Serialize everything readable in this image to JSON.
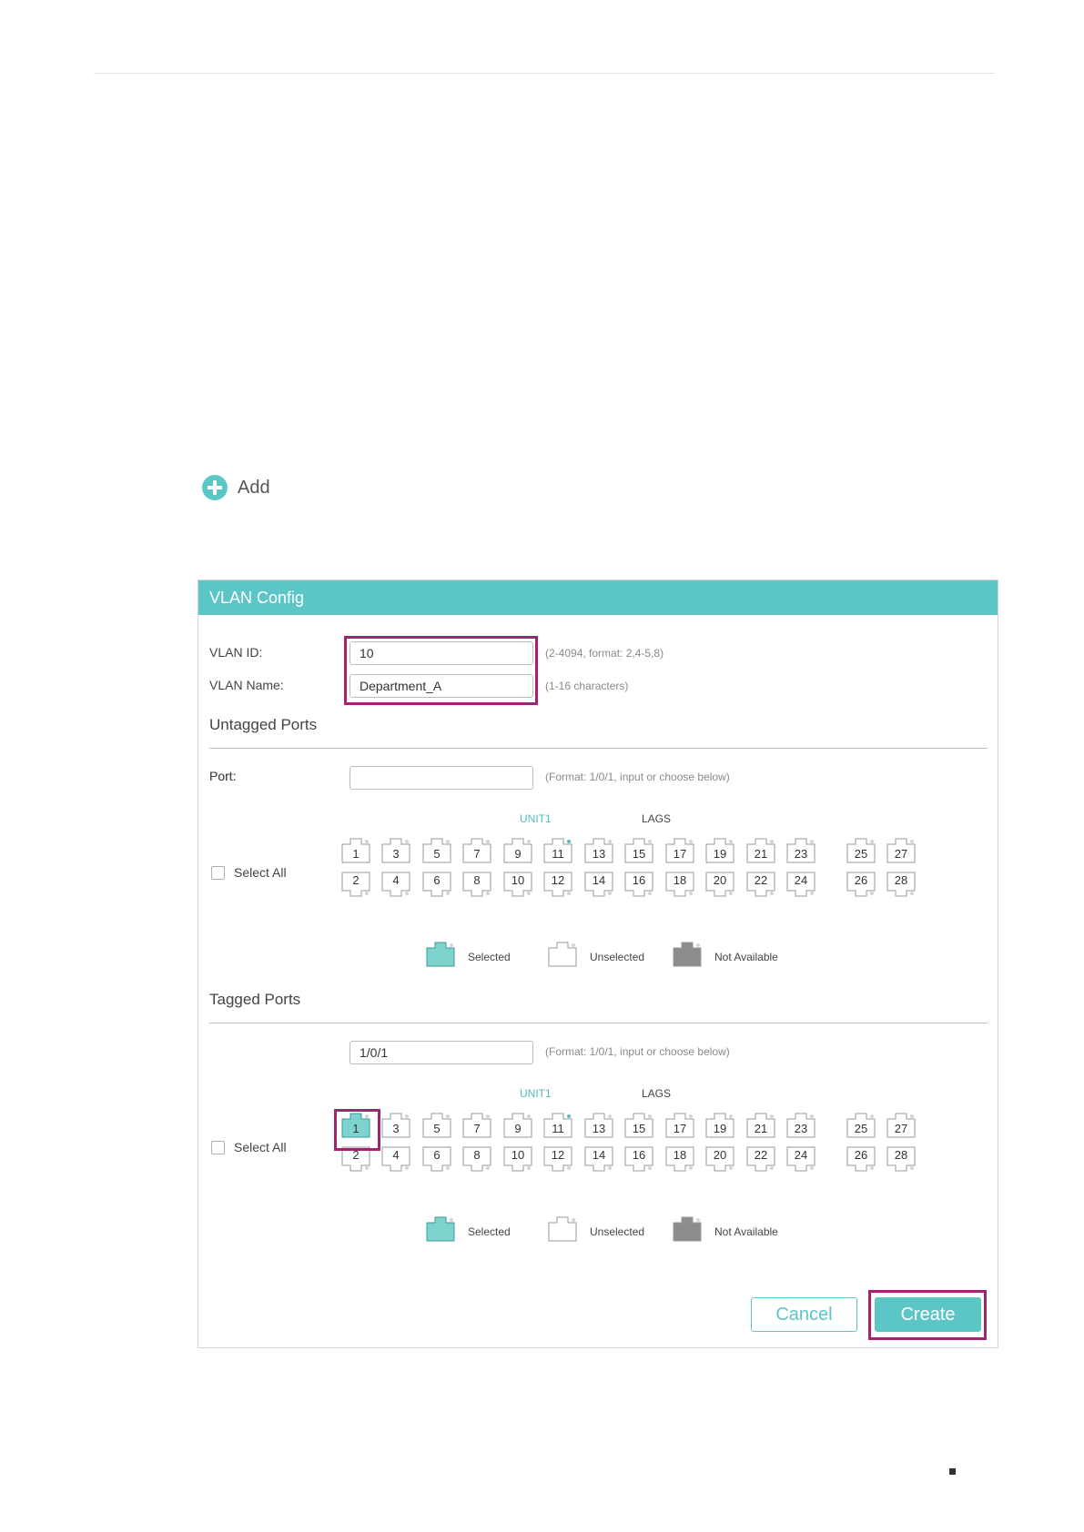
{
  "add": {
    "label": "Add"
  },
  "panel": {
    "title": "VLAN Config"
  },
  "vlan_id": {
    "label": "VLAN ID:",
    "value": "10",
    "hint": "(2-4094, format: 2,4-5,8)"
  },
  "vlan_name": {
    "label": "VLAN Name:",
    "value": "Department_A",
    "hint": "(1-16 characters)"
  },
  "untagged": {
    "title": "Untagged Ports",
    "port_label": "Port:",
    "port_value": "",
    "port_hint": "(Format: 1/0/1, input or choose below)",
    "unit_label": "UNIT1",
    "lags_label": "LAGS",
    "select_all": "Select All",
    "selected_ports": []
  },
  "tagged": {
    "title": "Tagged Ports",
    "port_label": "Port:",
    "port_value": "1/0/1",
    "port_hint": "(Format: 1/0/1, input or choose below)",
    "unit_label": "UNIT1",
    "lags_label": "LAGS",
    "select_all": "Select All",
    "selected_ports": [
      "1"
    ]
  },
  "ports": {
    "top": [
      "1",
      "3",
      "5",
      "7",
      "9",
      "11",
      "13",
      "15",
      "17",
      "19",
      "21",
      "23",
      "25",
      "27"
    ],
    "bottom": [
      "2",
      "4",
      "6",
      "8",
      "10",
      "12",
      "14",
      "16",
      "18",
      "20",
      "22",
      "24",
      "26",
      "28"
    ]
  },
  "legend": {
    "selected": "Selected",
    "unselected": "Unselected",
    "not_available": "Not Available"
  },
  "buttons": {
    "cancel": "Cancel",
    "create": "Create"
  },
  "colors": {
    "accent": "#5cc6c6",
    "highlight": "#a3246e",
    "selected_port": "#7fd3cf",
    "not_available": "#8c8c8c",
    "active_led": "#4fbcbc"
  }
}
